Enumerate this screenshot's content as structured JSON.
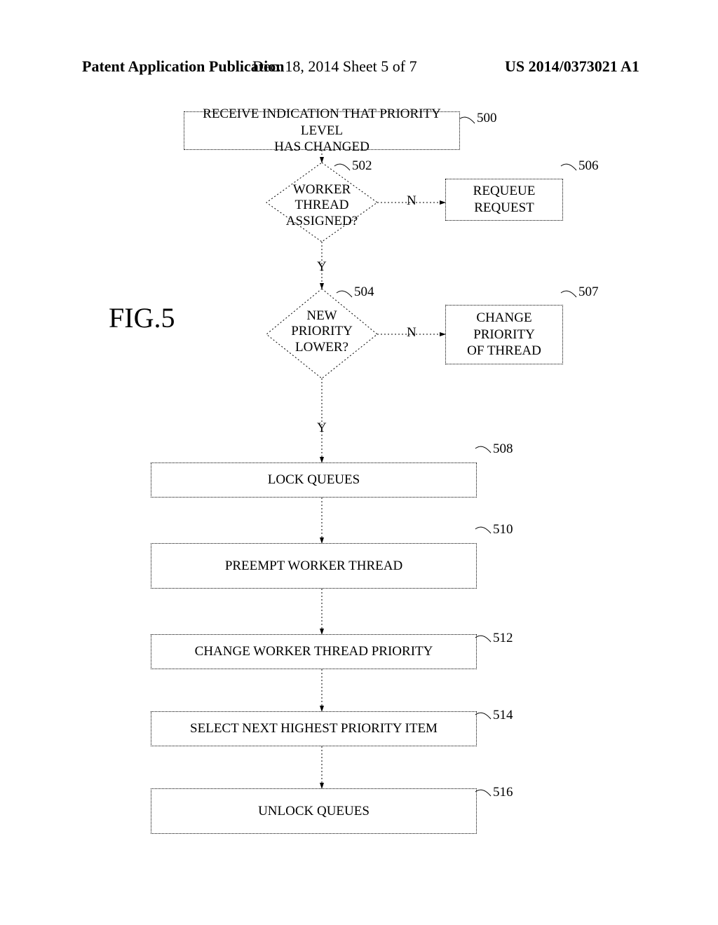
{
  "header": {
    "left": "Patent Application Publication",
    "mid": "Dec. 18, 2014  Sheet 5 of 7",
    "right": "US 2014/0373021 A1"
  },
  "figure_label": "FIG.5",
  "refs": {
    "r500": "500",
    "r502": "502",
    "r504": "504",
    "r506": "506",
    "r507": "507",
    "r508": "508",
    "r510": "510",
    "r512": "512",
    "r514": "514",
    "r516": "516"
  },
  "edge": {
    "yes": "Y",
    "no": "N"
  },
  "nodes": {
    "n500": "RECEIVE INDICATION THAT PRIORITY LEVEL\nHAS CHANGED",
    "n502": "WORKER\nTHREAD\nASSIGNED?",
    "n504": "NEW\nPRIORITY\nLOWER?",
    "n506": "REQUEUE\nREQUEST",
    "n507": "CHANGE\nPRIORITY\nOF THREAD",
    "n508": "LOCK QUEUES",
    "n510": "PREEMPT WORKER THREAD",
    "n512": "CHANGE WORKER THREAD PRIORITY",
    "n514": "SELECT NEXT HIGHEST PRIORITY ITEM",
    "n516": "UNLOCK QUEUES"
  }
}
